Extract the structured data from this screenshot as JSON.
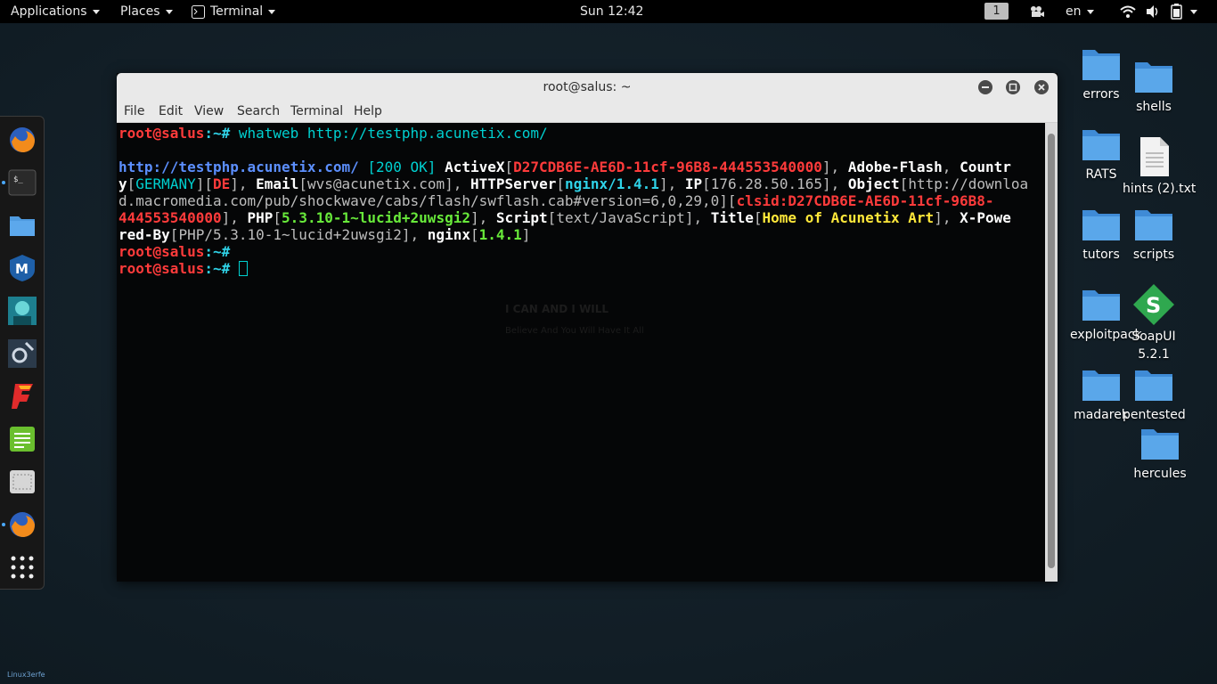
{
  "topbar": {
    "applications": "Applications",
    "places": "Places",
    "terminal": "Terminal",
    "clock": "Sun 12:42",
    "workspace": "1",
    "language": "en"
  },
  "window": {
    "title": "root@salus: ~",
    "menu": [
      "File",
      "Edit",
      "View",
      "Search",
      "Terminal",
      "Help"
    ]
  },
  "terminal": {
    "prompt_user": "root@salus",
    "prompt_path": ":~#",
    "command": " whatweb http://testphp.acunetix.com/",
    "output": {
      "url": "http://testphp.acunetix.com/",
      "status": "[200 OK]",
      "activex_id": "D27CDB6E-AE6D-11cf-96B8-444553540000",
      "country": "GERMANY",
      "country_code": "DE",
      "email": "wvs@acunetix.com",
      "http_server": "nginx/1.4.1",
      "ip": "176.28.50.165",
      "object_url": "http://download.macromedia.com/pub/shockwave/cabs/flash/swflash.cab#version=6,0,29,0",
      "clsid": "clsid:D27CDB6E-AE6D-11cf-96B8-444553540000",
      "php": "5.3.10-1~lucid+2uwsgi2",
      "script": "text/JavaScript",
      "title": "Home of Acunetix Art",
      "x_powered_by": "PHP/5.3.10-1~lucid+2uwsgi2",
      "nginx": "1.4.1"
    },
    "wallpaper_line1": "I CAN AND I WILL",
    "wallpaper_line2": "Believe And You Will Have It All"
  },
  "desktop_icons": [
    {
      "label": "errors",
      "icon": "folder-icon"
    },
    {
      "label": "shells",
      "icon": "folder-icon"
    },
    {
      "label": "RATS",
      "icon": "folder-icon"
    },
    {
      "label": "hints (2).txt",
      "icon": "text-file-icon"
    },
    {
      "label": "tutors",
      "icon": "folder-icon"
    },
    {
      "label": "scripts",
      "icon": "folder-icon"
    },
    {
      "label": "exploitpack",
      "icon": "folder-icon"
    },
    {
      "label": "SoapUI 5.2.1",
      "icon": "soapui-icon"
    },
    {
      "label": "madarek",
      "icon": "folder-icon"
    },
    {
      "label": "pentested",
      "icon": "folder-icon"
    },
    {
      "label": "hercules",
      "icon": "folder-icon"
    }
  ],
  "dock_items": [
    "firefox-icon",
    "terminal-icon",
    "files-icon",
    "metasploit-icon",
    "avatar-app-icon",
    "burpsuite-icon",
    "faraday-icon",
    "notes-icon",
    "screenshot-icon",
    "firefox-icon",
    "show-apps-icon"
  ],
  "watermark": "Linux3erfe",
  "colors": {
    "folder": "#4f9be0",
    "prompt_red": "#ff3b3b",
    "cyan": "#00d0d0"
  }
}
